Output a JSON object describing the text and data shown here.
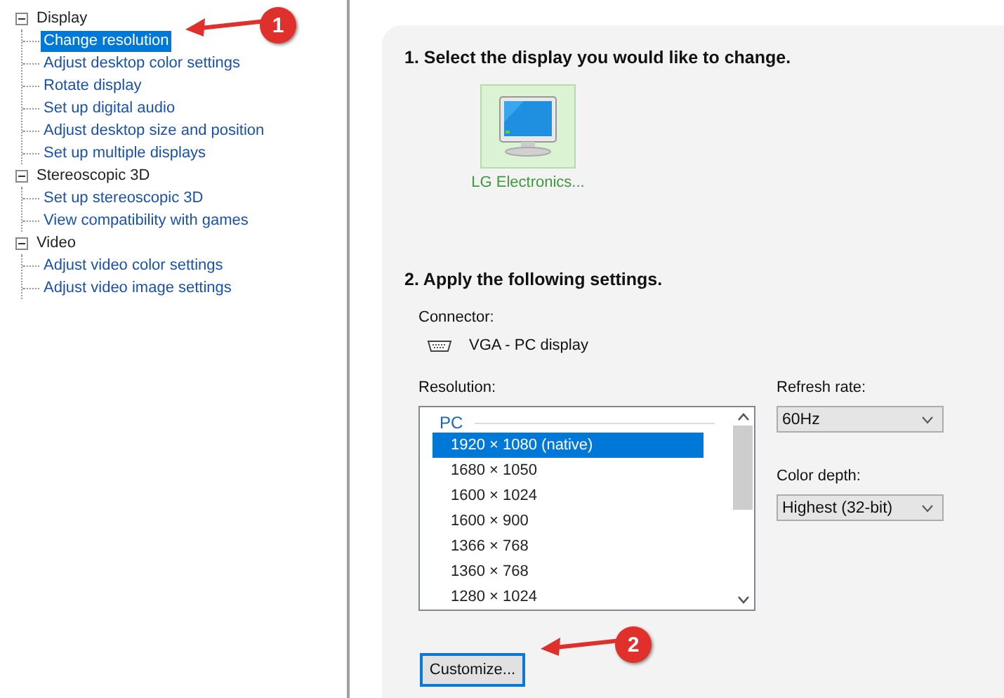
{
  "tree": [
    {
      "label": "Display",
      "expanded": true,
      "selected": false,
      "children": [
        {
          "label": "Change resolution",
          "selected": true
        },
        {
          "label": "Adjust desktop color settings",
          "selected": false
        },
        {
          "label": "Rotate display",
          "selected": false
        },
        {
          "label": "Set up digital audio",
          "selected": false
        },
        {
          "label": "Adjust desktop size and position",
          "selected": false
        },
        {
          "label": "Set up multiple displays",
          "selected": false
        }
      ]
    },
    {
      "label": "Stereoscopic 3D",
      "expanded": true,
      "selected": false,
      "children": [
        {
          "label": "Set up stereoscopic 3D",
          "selected": false
        },
        {
          "label": "View compatibility with games",
          "selected": false
        }
      ]
    },
    {
      "label": "Video",
      "expanded": true,
      "selected": false,
      "children": [
        {
          "label": "Adjust video color settings",
          "selected": false
        },
        {
          "label": "Adjust video image settings",
          "selected": false
        }
      ]
    }
  ],
  "step1": {
    "heading": "1. Select the display you would like to change.",
    "displays": [
      {
        "name": "LG Electronics...",
        "selected": true
      }
    ]
  },
  "step2": {
    "heading": "2. Apply the following settings.",
    "connector_label": "Connector:",
    "connector": "VGA - PC display",
    "resolution_label": "Resolution:",
    "resolution_group": "PC",
    "resolutions": [
      {
        "label": "1920 × 1080 (native)",
        "selected": true
      },
      {
        "label": "1680 × 1050",
        "selected": false
      },
      {
        "label": "1600 × 1024",
        "selected": false
      },
      {
        "label": "1600 × 900",
        "selected": false
      },
      {
        "label": "1366 × 768",
        "selected": false
      },
      {
        "label": "1360 × 768",
        "selected": false
      },
      {
        "label": "1280 × 1024",
        "selected": false
      }
    ],
    "refresh_label": "Refresh rate:",
    "refresh_value": "60Hz",
    "depth_label": "Color depth:",
    "depth_value": "Highest (32-bit)",
    "customize_button": "Customize..."
  },
  "annotations": [
    {
      "number": "1"
    },
    {
      "number": "2"
    }
  ]
}
